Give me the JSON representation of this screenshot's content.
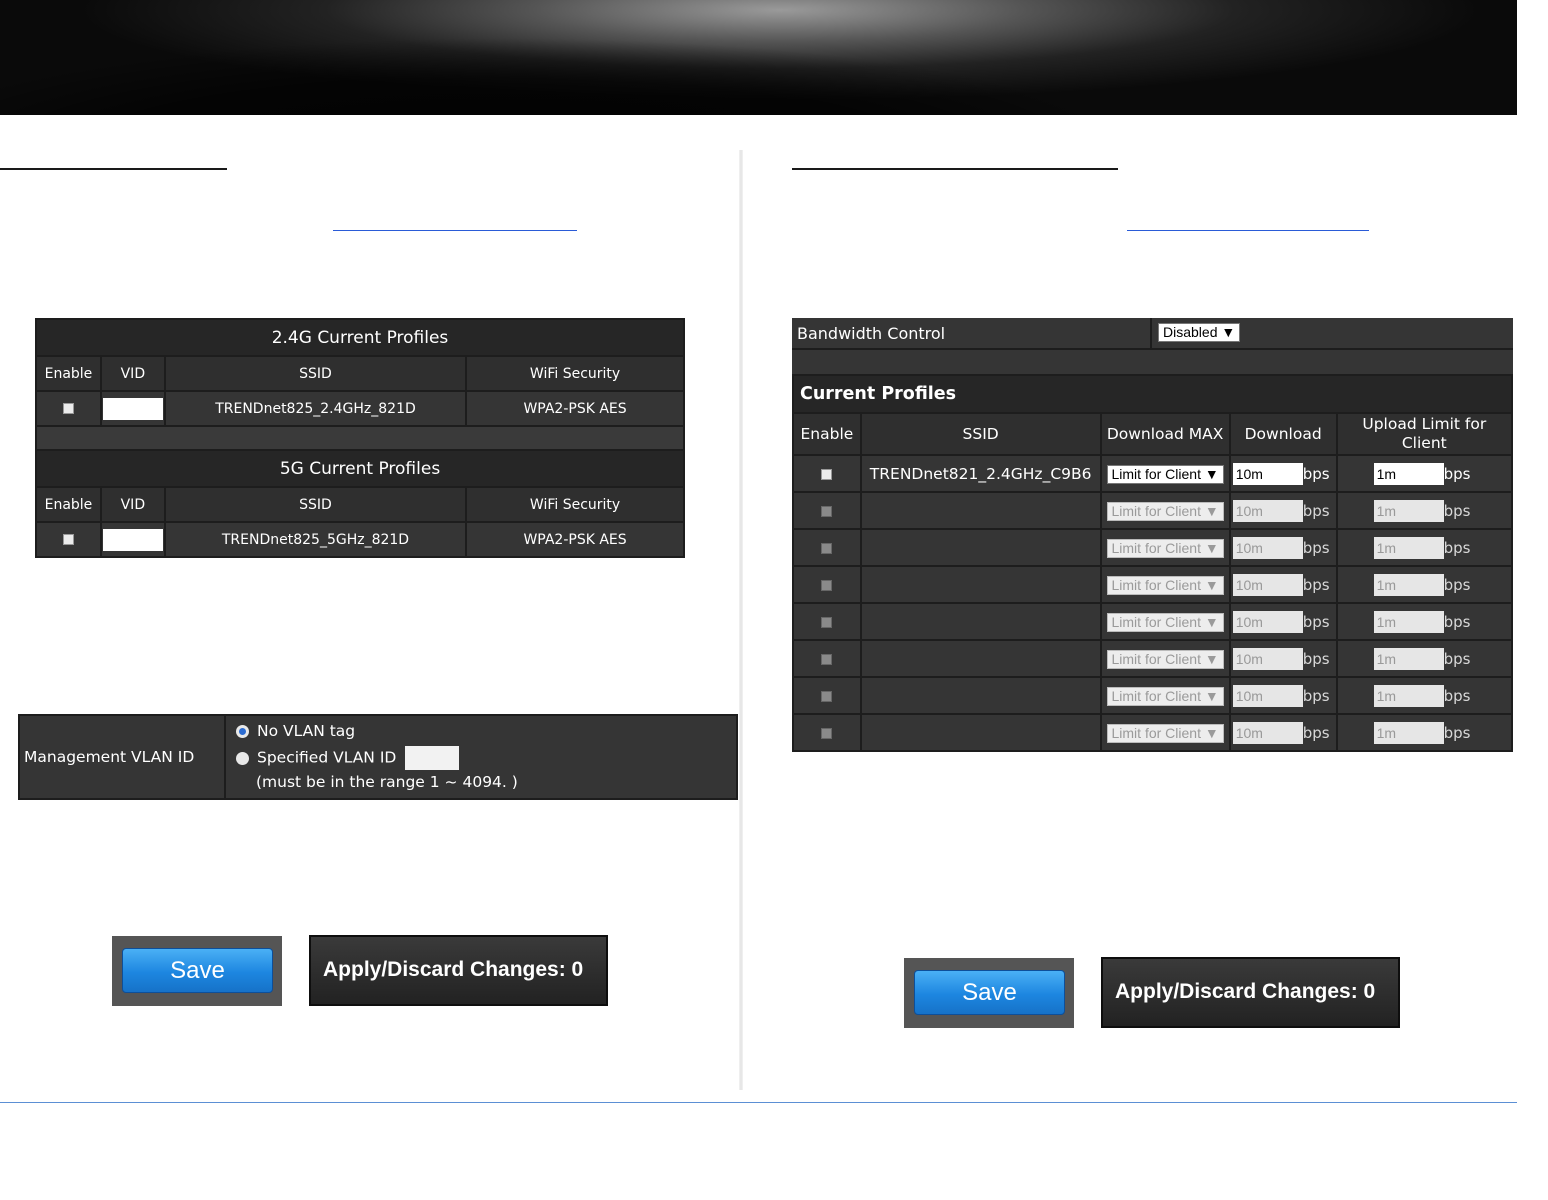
{
  "left": {
    "profiles_24g": {
      "title": "2.4G Current Profiles",
      "headers": [
        "Enable",
        "VID",
        "SSID",
        "WiFi Security"
      ],
      "rows": [
        {
          "ssid": "TRENDnet825_2.4GHz_821D",
          "security": "WPA2-PSK AES"
        }
      ]
    },
    "profiles_5g": {
      "title": "5G Current Profiles",
      "headers": [
        "Enable",
        "VID",
        "SSID",
        "WiFi Security"
      ],
      "rows": [
        {
          "ssid": "TRENDnet825_5GHz_821D",
          "security": "WPA2-PSK AES"
        }
      ]
    },
    "vlan": {
      "label": "Management VLAN ID",
      "option_no_tag": "No VLAN tag",
      "option_specified": "Specified VLAN ID",
      "range_note": "(must be in the range 1 ~ 4094. )"
    },
    "save_label": "Save",
    "apply_label": "Apply/Discard Changes: 0"
  },
  "right": {
    "bandwidth_label": "Bandwidth Control",
    "bandwidth_value": "Disabled ▼",
    "profiles_title": "Current Profiles",
    "headers": [
      "Enable",
      "SSID",
      "Download MAX",
      "Download",
      "Upload Limit for Client"
    ],
    "rows": [
      {
        "ssid": "TRENDnet821_2.4GHz_C9B6",
        "mode": "Limit for Client ▼",
        "download": "10m",
        "upload": "1m",
        "unit": "bps",
        "active": true
      },
      {
        "ssid": "",
        "mode": "Limit for Client ▼",
        "download": "10m",
        "upload": "1m",
        "unit": "bps",
        "active": false
      },
      {
        "ssid": "",
        "mode": "Limit for Client ▼",
        "download": "10m",
        "upload": "1m",
        "unit": "bps",
        "active": false
      },
      {
        "ssid": "",
        "mode": "Limit for Client ▼",
        "download": "10m",
        "upload": "1m",
        "unit": "bps",
        "active": false
      },
      {
        "ssid": "",
        "mode": "Limit for Client ▼",
        "download": "10m",
        "upload": "1m",
        "unit": "bps",
        "active": false
      },
      {
        "ssid": "",
        "mode": "Limit for Client ▼",
        "download": "10m",
        "upload": "1m",
        "unit": "bps",
        "active": false
      },
      {
        "ssid": "",
        "mode": "Limit for Client ▼",
        "download": "10m",
        "upload": "1m",
        "unit": "bps",
        "active": false
      },
      {
        "ssid": "",
        "mode": "Limit for Client ▼",
        "download": "10m",
        "upload": "1m",
        "unit": "bps",
        "active": false
      }
    ],
    "save_label": "Save",
    "apply_label": "Apply/Discard Changes: 0"
  }
}
